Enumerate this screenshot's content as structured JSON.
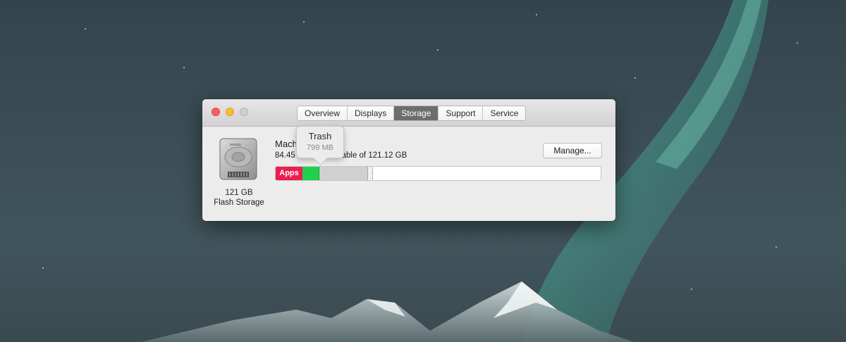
{
  "window": {
    "tabs": [
      "Overview",
      "Displays",
      "Storage",
      "Support",
      "Service"
    ],
    "active_tab": "Storage"
  },
  "disk": {
    "capacity": "121 GB",
    "type": "Flash Storage",
    "icon": "hard-drive-icon"
  },
  "storage": {
    "name": "Mach",
    "available_left": "84.45 GB",
    "available_right": "able of 121.12 GB",
    "manage_label": "Manage...",
    "segments": [
      {
        "label": "Apps",
        "color": "#ee1c4f"
      },
      {
        "label": "",
        "color": "#1fd24d"
      },
      {
        "label": "",
        "color": "#d0d0d0"
      }
    ]
  },
  "tooltip": {
    "title": "Trash",
    "size": "799 MB"
  },
  "colors": {
    "apps": "#ee1c4f",
    "close": "#fc5f57",
    "minimize": "#fdbc2e",
    "active_tab": "#6d6d6d"
  }
}
